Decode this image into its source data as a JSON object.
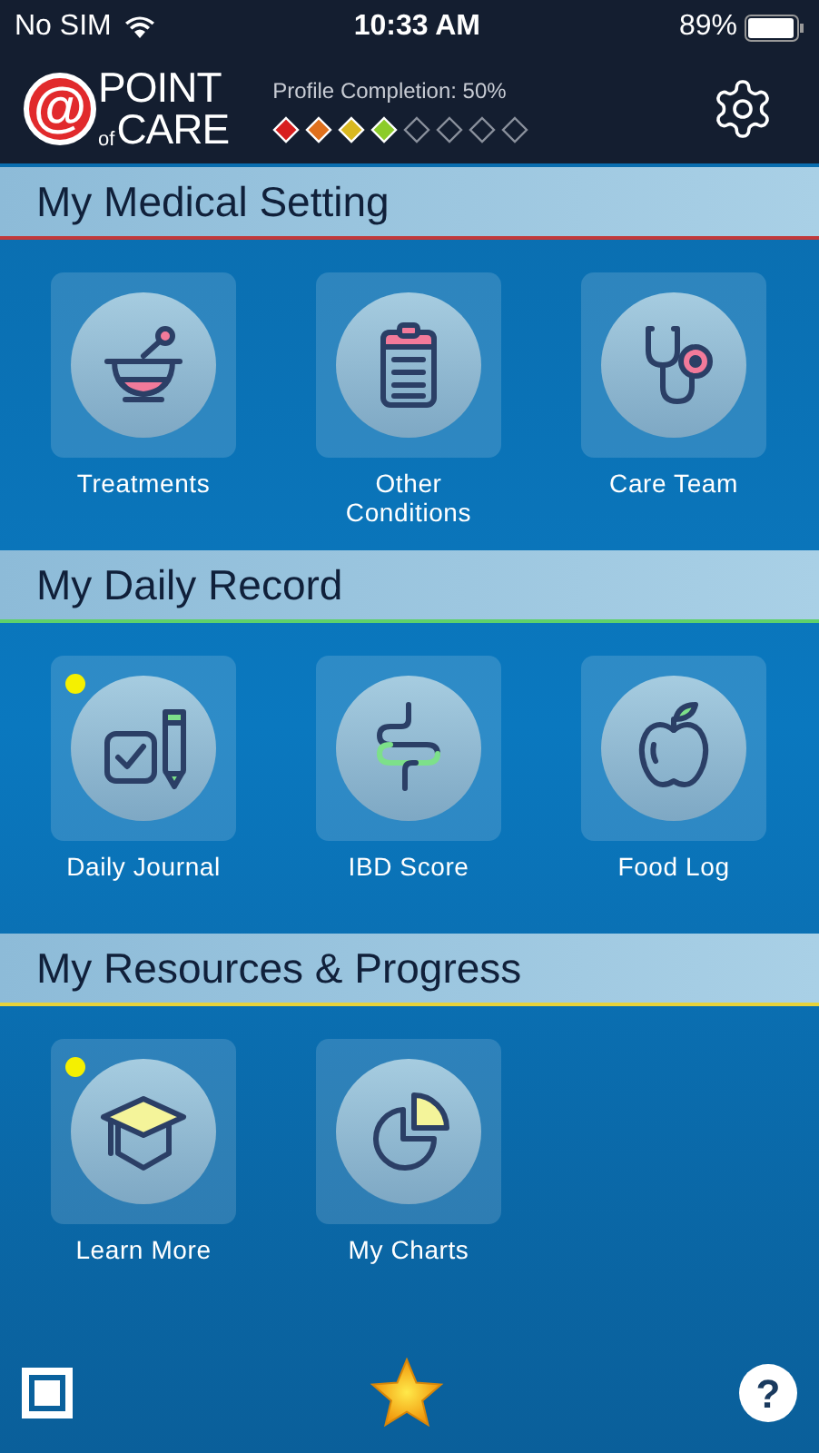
{
  "status_bar": {
    "carrier": "No SIM",
    "time": "10:33 AM",
    "battery": "89%"
  },
  "header": {
    "logo": {
      "at": "@",
      "point": "POINT",
      "of": "of",
      "care": "CARE"
    },
    "profile": {
      "label": "Profile Completion: 50%",
      "steps": [
        {
          "filled": true,
          "color": "#d81e1e"
        },
        {
          "filled": true,
          "color": "#e0701c"
        },
        {
          "filled": true,
          "color": "#d9b820"
        },
        {
          "filled": true,
          "color": "#8ccc2a"
        },
        {
          "filled": false
        },
        {
          "filled": false
        },
        {
          "filled": false
        },
        {
          "filled": false
        }
      ]
    }
  },
  "sections": [
    {
      "title": "My Medical Setting",
      "color": "#c0393b",
      "tiles": [
        {
          "label": "Treatments",
          "kind": "mortar",
          "badge": false
        },
        {
          "label": "Other Conditions",
          "kind": "clipboard",
          "badge": false
        },
        {
          "label": "Care Team",
          "kind": "stethoscope",
          "badge": false
        }
      ]
    },
    {
      "title": "My Daily Record",
      "color": "#5fd06a",
      "tiles": [
        {
          "label": "Daily Journal",
          "kind": "journal",
          "badge": true
        },
        {
          "label": "IBD Score",
          "kind": "intestine",
          "badge": false
        },
        {
          "label": "Food Log",
          "kind": "apple",
          "badge": false
        }
      ]
    },
    {
      "title": "My Resources & Progress",
      "color": "#e8d23a",
      "tiles": [
        {
          "label": "Learn More",
          "kind": "cap",
          "badge": true
        },
        {
          "label": "My Charts",
          "kind": "pie",
          "badge": false
        }
      ]
    }
  ],
  "footer": {
    "help": "?"
  }
}
